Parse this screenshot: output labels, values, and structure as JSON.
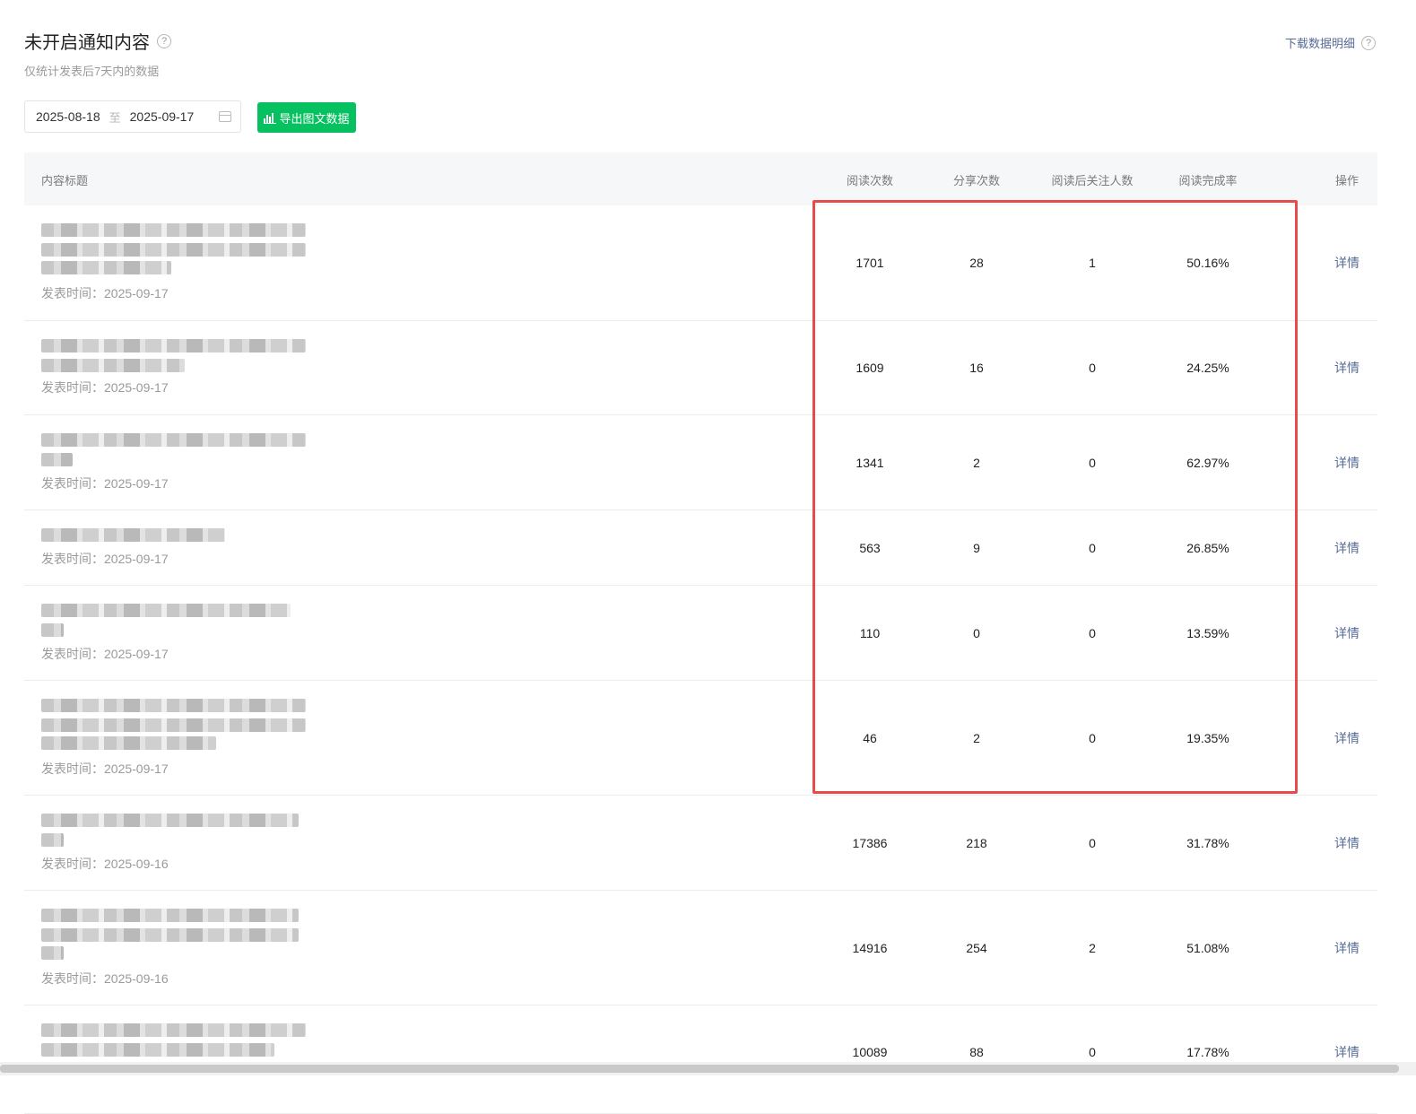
{
  "header": {
    "title": "未开启通知内容",
    "subtitle": "仅统计发表后7天内的数据",
    "download_label": "下载数据明细"
  },
  "filter": {
    "start_date": "2025-08-18",
    "separator": "至",
    "end_date": "2025-09-17",
    "export_label": "导出图文数据",
    "accent_color": "#07c160"
  },
  "table": {
    "columns": [
      "内容标题",
      "阅读次数",
      "分享次数",
      "阅读后关注人数",
      "阅读完成率",
      "操作"
    ],
    "rows": [
      {
        "publish": "发表时间：2025-09-17",
        "reads": "1701",
        "shares": "28",
        "follows": "1",
        "completion": "50.16%",
        "action": "详情"
      },
      {
        "publish": "发表时间：2025-09-17",
        "reads": "1609",
        "shares": "16",
        "follows": "0",
        "completion": "24.25%",
        "action": "详情"
      },
      {
        "publish": "发表时间：2025-09-17",
        "reads": "1341",
        "shares": "2",
        "follows": "0",
        "completion": "62.97%",
        "action": "详情"
      },
      {
        "publish": "发表时间：2025-09-17",
        "reads": "563",
        "shares": "9",
        "follows": "0",
        "completion": "26.85%",
        "action": "详情"
      },
      {
        "publish": "发表时间：2025-09-17",
        "reads": "110",
        "shares": "0",
        "follows": "0",
        "completion": "13.59%",
        "action": "详情"
      },
      {
        "publish": "发表时间：2025-09-17",
        "reads": "46",
        "shares": "2",
        "follows": "0",
        "completion": "19.35%",
        "action": "详情"
      },
      {
        "publish": "发表时间：2025-09-16",
        "reads": "17386",
        "shares": "218",
        "follows": "0",
        "completion": "31.78%",
        "action": "详情"
      },
      {
        "publish": "发表时间：2025-09-16",
        "reads": "14916",
        "shares": "254",
        "follows": "2",
        "completion": "51.08%",
        "action": "详情"
      },
      {
        "publish": "",
        "reads": "10089",
        "shares": "88",
        "follows": "0",
        "completion": "17.78%",
        "action": "详情"
      }
    ]
  },
  "highlight_color": "#e74c4c"
}
